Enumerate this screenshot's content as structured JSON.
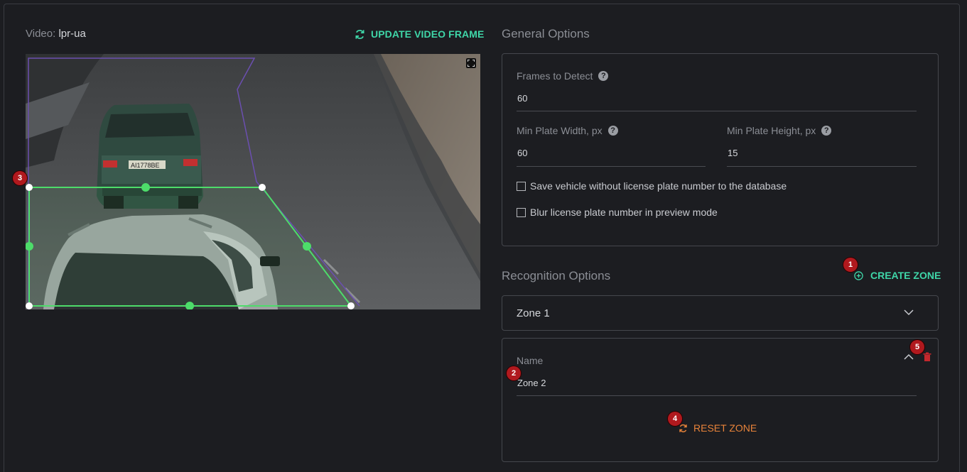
{
  "video": {
    "label_prefix": "Video:",
    "name": "lpr-ua",
    "update_button": "UPDATE VIDEO FRAME",
    "plate_text": "АІ1778ВЕ"
  },
  "general": {
    "title": "General Options",
    "frames_label": "Frames to Detect",
    "frames_value": "60",
    "min_width_label": "Min Plate Width, px",
    "min_width_value": "60",
    "min_height_label": "Min Plate Height, px",
    "min_height_value": "15",
    "save_vehicle_label": "Save vehicle without license plate number to the database",
    "blur_label": "Blur license plate number in preview mode"
  },
  "recognition": {
    "title": "Recognition Options",
    "create_zone": "CREATE ZONE",
    "zone_select": "Zone 1",
    "name_label": "Name",
    "name_value": "Zone 2",
    "reset_zone": "RESET ZONE"
  },
  "badges": [
    "1",
    "2",
    "3",
    "4",
    "5"
  ],
  "colors": {
    "accent": "#3fd6a8",
    "zone_line": "#4ddc6a",
    "reset": "#e8833a",
    "badge": "#b0191e",
    "delete": "#c4282d"
  },
  "icons": {
    "help": "?",
    "refresh": "refresh-icon",
    "plus": "plus-circle-icon",
    "chevron_down": "chevron-down-icon",
    "chevron_up": "chevron-up-icon",
    "trash": "trash-icon",
    "fullscreen": "fullscreen-icon"
  }
}
